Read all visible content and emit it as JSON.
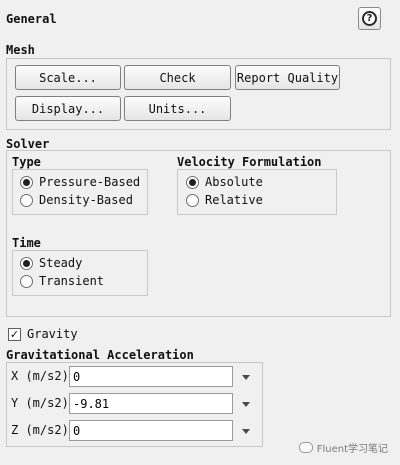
{
  "panel": {
    "title": "General",
    "help_icon": "question-icon",
    "help_glyph": "?"
  },
  "mesh": {
    "label": "Mesh",
    "buttons": {
      "scale": "Scale...",
      "check": "Check",
      "report_quality": "Report Quality",
      "display": "Display...",
      "units": "Units..."
    }
  },
  "solver": {
    "label": "Solver",
    "type": {
      "label": "Type",
      "options": [
        "Pressure-Based",
        "Density-Based"
      ],
      "selected": "Pressure-Based"
    },
    "velocity": {
      "label": "Velocity Formulation",
      "options": [
        "Absolute",
        "Relative"
      ],
      "selected": "Absolute"
    },
    "time": {
      "label": "Time",
      "options": [
        "Steady",
        "Transient"
      ],
      "selected": "Steady"
    }
  },
  "gravity": {
    "label": "Gravity",
    "checked": true,
    "check_glyph": "✓"
  },
  "gravitational_acceleration": {
    "label": "Gravitational Acceleration",
    "x": {
      "label": "X (m/s2)",
      "value": "0"
    },
    "y": {
      "label": "Y (m/s2)",
      "value": "-9.81"
    },
    "z": {
      "label": "Z (m/s2)",
      "value": "0"
    }
  },
  "watermark": "Fluent学习笔记"
}
